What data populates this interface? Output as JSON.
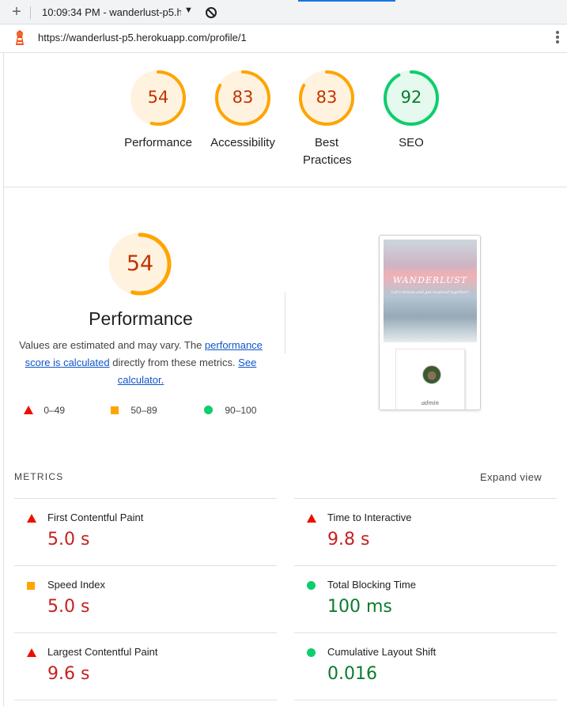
{
  "browser": {
    "new_tab_glyph": "+",
    "tab_title": "10:09:34 PM - wanderlust-p5.h",
    "tab_caret": "▼",
    "url": "https://wanderlust-p5.herokuapp.com/profile/1"
  },
  "categories": [
    {
      "label": "Performance",
      "score": "54",
      "status": "average"
    },
    {
      "label": "Accessibility",
      "score": "83",
      "status": "average"
    },
    {
      "label": "Best Practices",
      "score": "83",
      "status": "average"
    },
    {
      "label": "SEO",
      "score": "92",
      "status": "pass"
    }
  ],
  "performance": {
    "score": "54",
    "score_value": 0.54,
    "title": "Performance",
    "desc_before": "Values are estimated and may vary. The ",
    "link1": "performance score is calculated",
    "desc_middle": " directly from these metrics. ",
    "link2": "See calculator.",
    "legend": {
      "fail": "0–49",
      "average": "50–89",
      "pass": "90–100"
    }
  },
  "thumbnail": {
    "brand": "WANDERLUST",
    "tagline": "Let's dream and get inspired together!",
    "username": "admin"
  },
  "metrics": {
    "heading": "METRICS",
    "expand_label": "Expand view",
    "items": [
      {
        "name": "First Contentful Paint",
        "value": "5.0 s",
        "status": "fail"
      },
      {
        "name": "Time to Interactive",
        "value": "9.8 s",
        "status": "fail"
      },
      {
        "name": "Speed Index",
        "value": "5.0 s",
        "status": "average"
      },
      {
        "name": "Total Blocking Time",
        "value": "100 ms",
        "status": "pass"
      },
      {
        "name": "Largest Contentful Paint",
        "value": "9.6 s",
        "status": "fail"
      },
      {
        "name": "Cumulative Layout Shift",
        "value": "0.016",
        "status": "pass"
      }
    ]
  },
  "colors": {
    "average_ring": "#ffa400",
    "average_fill": "#fff3e0",
    "pass_ring": "#0cce6b",
    "pass_fill": "#e6f9ee",
    "fail": "#eb0f00",
    "link": "#1155cc"
  }
}
